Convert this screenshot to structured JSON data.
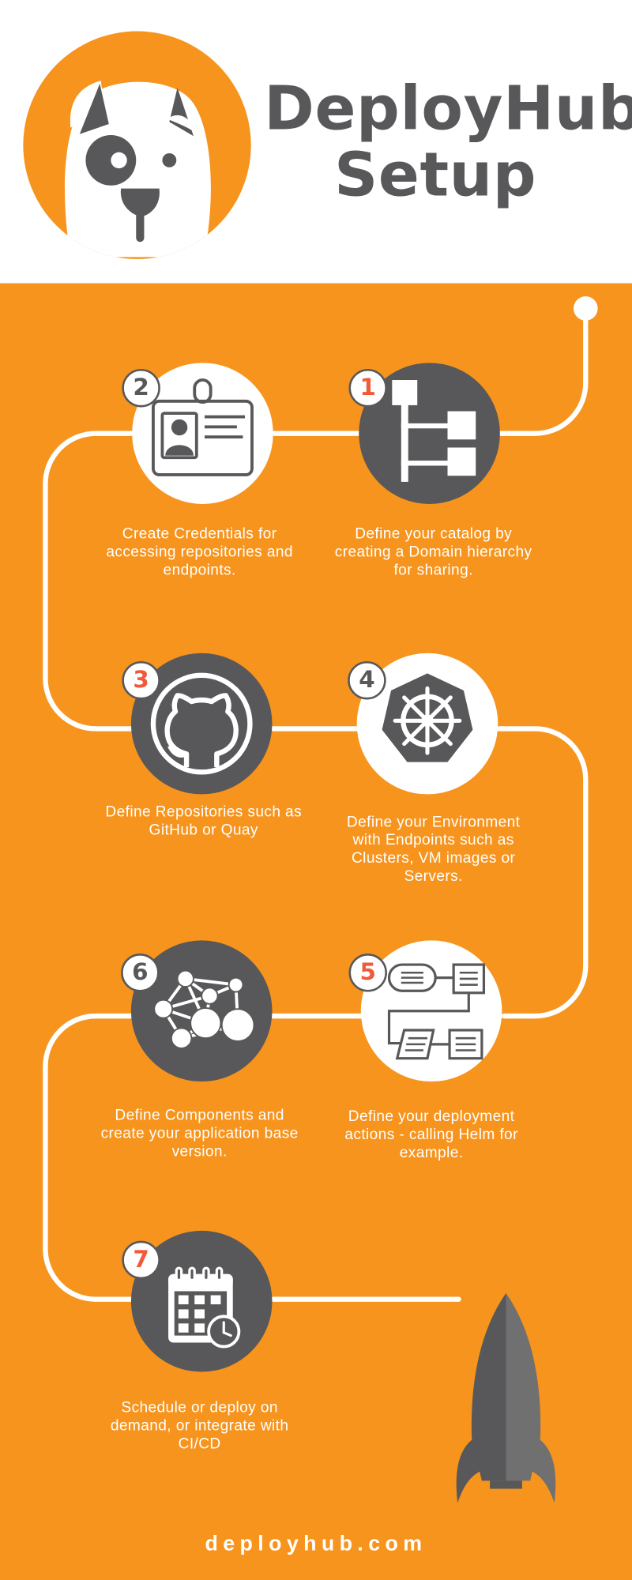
{
  "title_lines": [
    "DeployHub",
    "Setup"
  ],
  "colors": {
    "orange": "#f7941e",
    "dark_gray": "#58585a",
    "white": "#ffffff",
    "number_accent": "#f05a3a"
  },
  "steps": [
    {
      "number": "1",
      "icon": "domain-hierarchy-icon",
      "text_lines": [
        "Define your catalog by",
        "creating a Domain hierarchy",
        "for sharing."
      ]
    },
    {
      "number": "2",
      "icon": "id-badge-icon",
      "text_lines": [
        "Create Credentials for",
        "accessing repositories and",
        "endpoints."
      ]
    },
    {
      "number": "3",
      "icon": "github-icon",
      "text_lines": [
        "Define Repositories such as",
        "GitHub or Quay"
      ]
    },
    {
      "number": "4",
      "icon": "kubernetes-helm-icon",
      "text_lines": [
        "Define your Environment",
        "with Endpoints such as",
        "Clusters, VM images or",
        "Servers."
      ]
    },
    {
      "number": "5",
      "icon": "flowchart-icon",
      "text_lines": [
        "Define your deployment",
        "actions -  calling Helm for",
        "example."
      ]
    },
    {
      "number": "6",
      "icon": "network-nodes-icon",
      "text_lines": [
        "Define Components and",
        "create your application base",
        "version."
      ]
    },
    {
      "number": "7",
      "icon": "calendar-clock-icon",
      "text_lines": [
        "Schedule or deploy on",
        "demand, or integrate with",
        "CI/CD"
      ]
    }
  ],
  "footer": "deployhub.com"
}
